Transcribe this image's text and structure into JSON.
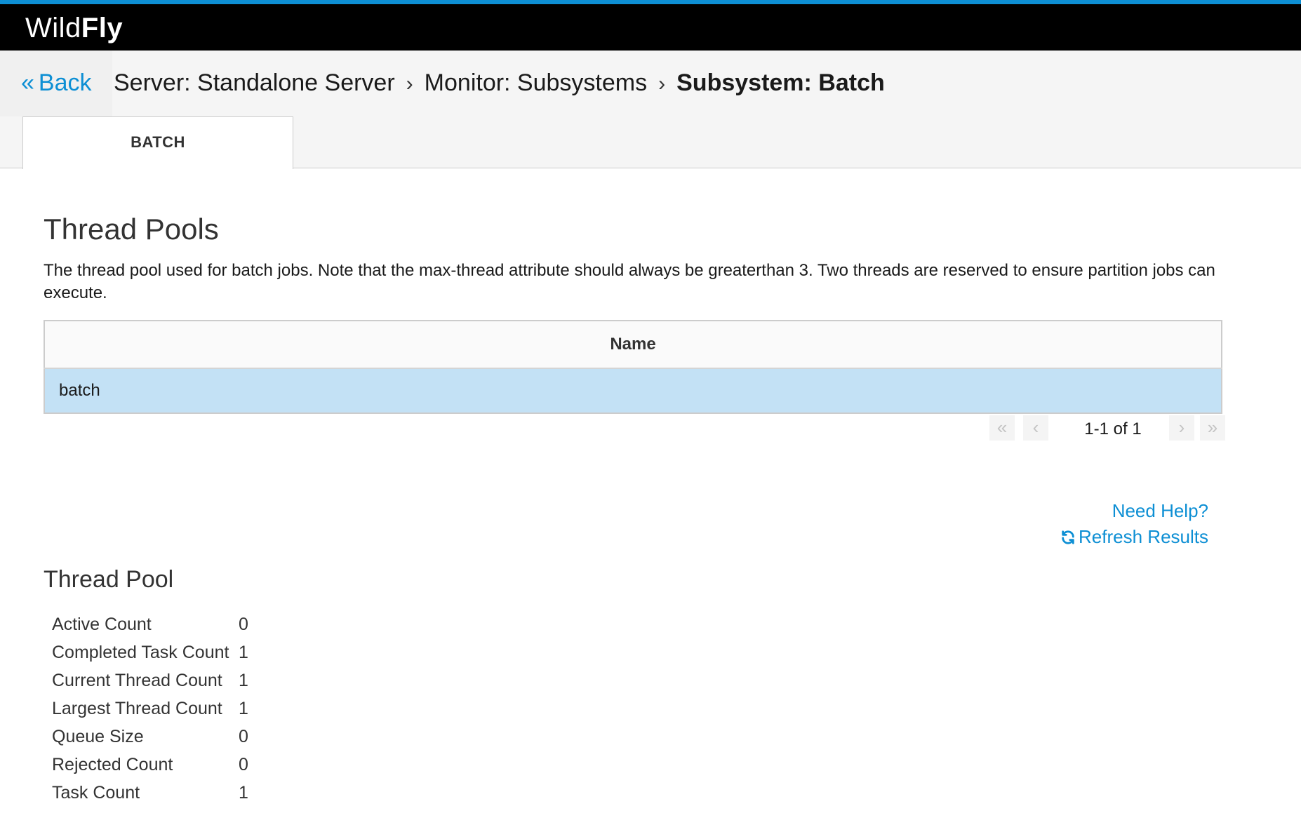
{
  "header": {
    "logo_light": "Wild",
    "logo_bold": "Fly",
    "accent_color": "#0d8fd4"
  },
  "breadcrumb": {
    "back_label": "Back",
    "items": [
      {
        "label": "Server: Standalone Server"
      },
      {
        "label": "Monitor: Subsystems"
      },
      {
        "label": "Subsystem: Batch"
      }
    ]
  },
  "tabs": [
    {
      "label": "BATCH",
      "active": true
    }
  ],
  "thread_pools": {
    "title": "Thread Pools",
    "description": "The thread pool used for batch jobs. Note that the max-thread attribute should always be greaterthan 3. Two threads are reserved to ensure partition jobs can execute.",
    "table": {
      "columns": [
        "Name"
      ],
      "rows": [
        {
          "name": "batch",
          "selected": true
        }
      ]
    },
    "pager": {
      "text": "1-1 of 1",
      "first_icon": "double-chevron-left-icon",
      "prev_icon": "chevron-left-icon",
      "next_icon": "chevron-right-icon",
      "last_icon": "double-chevron-right-icon"
    }
  },
  "links": {
    "help": "Need Help?",
    "refresh": "Refresh Results",
    "refresh_icon": "refresh-icon"
  },
  "thread_pool": {
    "title": "Thread Pool",
    "attributes": [
      {
        "name": "Active Count",
        "value": "0"
      },
      {
        "name": "Completed Task Count",
        "value": "1"
      },
      {
        "name": "Current Thread Count",
        "value": "1"
      },
      {
        "name": "Largest Thread Count",
        "value": "1"
      },
      {
        "name": "Queue Size",
        "value": "0"
      },
      {
        "name": "Rejected Count",
        "value": "0"
      },
      {
        "name": "Task Count",
        "value": "1"
      }
    ]
  }
}
